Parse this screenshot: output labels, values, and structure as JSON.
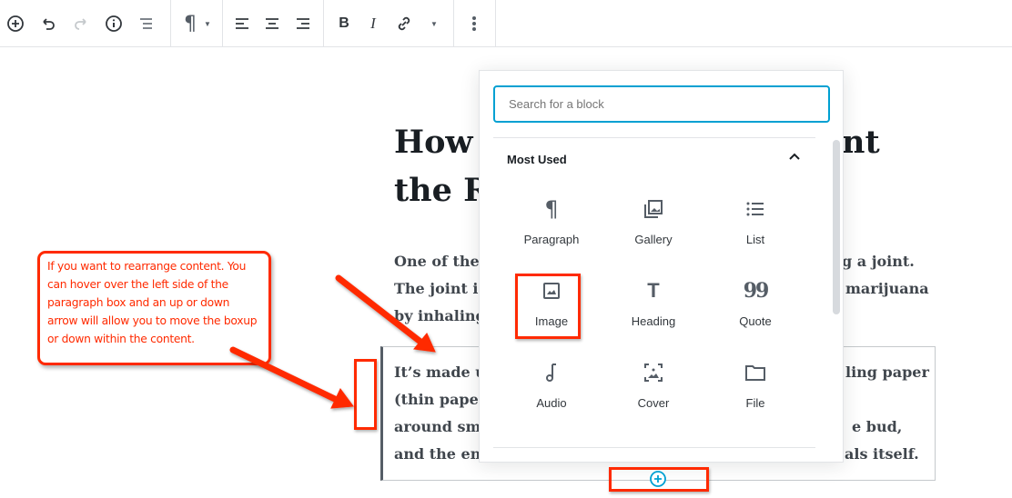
{
  "toolbar": {
    "buttons": [
      "add-block",
      "undo",
      "redo",
      "info",
      "outline",
      "paragraph",
      "align-left",
      "align-center",
      "align-right",
      "bold",
      "italic",
      "link",
      "more-rich-text",
      "more-options"
    ],
    "bold_label": "B",
    "italic_label": "I"
  },
  "post": {
    "title_visible": [
      {
        "left": "How ",
        "right": "nt"
      },
      {
        "left": "the R",
        "right": ""
      }
    ],
    "paragraph1": [
      {
        "left": "One of the ",
        "right": "g a joint."
      },
      {
        "left": "The joint is",
        "right": "marijuana"
      },
      {
        "left": "by inhaling",
        "right": ""
      }
    ],
    "paragraph2": [
      {
        "left": "It’s made u",
        "right": "ling paper"
      },
      {
        "left": "(thin paper",
        "right": ""
      },
      {
        "left": "around smo",
        "right": "e bud,"
      },
      {
        "left": "and the en",
        "right": "als itself."
      }
    ]
  },
  "inserter": {
    "search_placeholder": "Search for a block",
    "search_value": "",
    "section_title": "Most Used",
    "blocks": [
      {
        "label": "Paragraph",
        "icon": "paragraph-icon"
      },
      {
        "label": "Gallery",
        "icon": "gallery-icon"
      },
      {
        "label": "List",
        "icon": "list-icon"
      },
      {
        "label": "Image",
        "icon": "image-icon"
      },
      {
        "label": "Heading",
        "icon": "heading-icon"
      },
      {
        "label": "Quote",
        "icon": "quote-icon"
      },
      {
        "label": "Audio",
        "icon": "audio-icon"
      },
      {
        "label": "Cover",
        "icon": "cover-icon"
      },
      {
        "label": "File",
        "icon": "file-icon"
      }
    ]
  },
  "annotation": {
    "callout_text": "If you want to rearrange content. You can hover over the left side of the paragraph box and an up or down arrow will allow you to move the boxup or down within the content.",
    "color": "#ff2a00"
  },
  "colors": {
    "accent": "#00a0d2",
    "annotation": "#ff2a00"
  }
}
